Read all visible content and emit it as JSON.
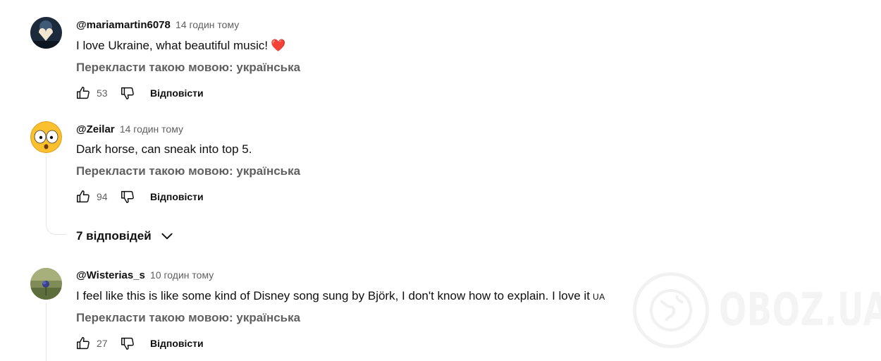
{
  "comments": [
    {
      "author": "@mariamartin6078",
      "time": "14 годин тому",
      "text": "I love Ukraine, what beautiful music!",
      "emoji": "❤️",
      "translate": "Перекласти такою мовою: українська",
      "likes": "53",
      "reply": "Відповісти"
    },
    {
      "author": "@Zeilar",
      "time": "14 годин тому",
      "text": "Dark horse, can sneak into top 5.",
      "translate": "Перекласти такою мовою: українська",
      "likes": "94",
      "reply": "Відповісти",
      "replies_toggle": "7 відповідей"
    },
    {
      "author": "@Wisterias_s",
      "time": "10 годин тому",
      "text": "I feel like this is like some kind of Disney song sung by Björk, I don't know how to explain. I love it",
      "tag": "UA",
      "translate": "Перекласти такою мовою: українська",
      "likes": "27",
      "reply": "Відповісти"
    }
  ],
  "watermark": "OBOZ.UA",
  "icons": {
    "like": "thumbs-up-icon",
    "dislike": "thumbs-down-icon",
    "expand": "chevron-down-icon",
    "watermark_logo": "globe-icon"
  },
  "colors": {
    "secondary_text": "#606060",
    "heart": "#e0162b"
  }
}
